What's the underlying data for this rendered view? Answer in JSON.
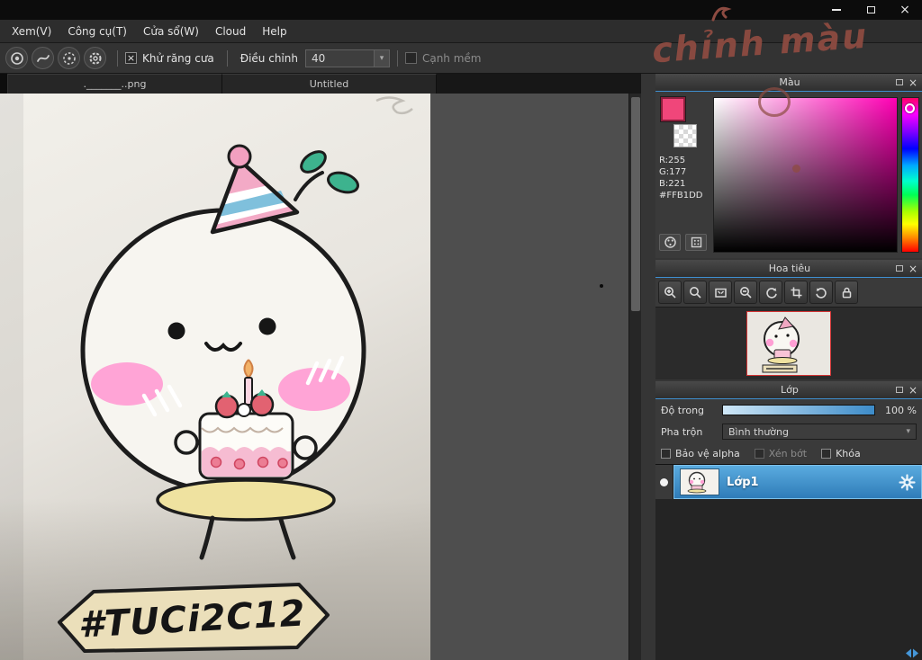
{
  "icons": {
    "close": "×",
    "panel_close": "×",
    "dropdown": "▾",
    "checkbox_checked": "×"
  },
  "menu": {
    "items": [
      "Xem(V)",
      "Công cụ(T)",
      "Cửa sổ(W)",
      "Cloud",
      "Help"
    ]
  },
  "toolbar": {
    "antialias_label": "Khử răng cưa",
    "adjust_label": "Điều chỉnh",
    "adjust_value": "40",
    "soft_edge_label": "Cạnh mềm"
  },
  "tabs": [
    {
      "label": "._______..png"
    },
    {
      "label": "Untitled"
    }
  ],
  "annotation": {
    "text": "chỉnh màu"
  },
  "color_panel": {
    "title": "Màu",
    "r": "R:255",
    "g": "G:177",
    "b": "B:221",
    "hex": "#FFB1DD"
  },
  "navigator_panel": {
    "title": "Hoa tiêu"
  },
  "layer_panel": {
    "title": "Lớp",
    "opacity_label": "Độ trong",
    "opacity_value": "100 %",
    "blend_label": "Pha trộn",
    "blend_value": "Bình thường",
    "checkboxes": [
      "Bảo vệ alpha",
      "Xén bớt",
      "Khóa"
    ],
    "layers": [
      {
        "name": "Lớp1"
      }
    ]
  },
  "canvas": {
    "sign_text": "#TUCi2C12"
  },
  "colors": {
    "current_hex": "#FFB1DD",
    "selection": "#3e95d6",
    "annotation_ink": "#8d4b41"
  }
}
